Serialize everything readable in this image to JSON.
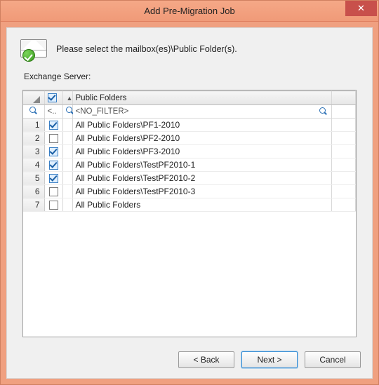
{
  "window": {
    "title": "Add Pre-Migration Job",
    "close_glyph": "✕"
  },
  "instruction": "Please select the mailbox(es)\\Public Folder(s).",
  "section_label": "Exchange Server:",
  "grid": {
    "header": {
      "col_path": "Public Folders"
    },
    "header_checkbox_checked": true,
    "filter": {
      "prefix": "<..",
      "placeholder": "<NO_FILTER>"
    },
    "rows": [
      {
        "n": "1",
        "checked": true,
        "path": "All Public Folders\\PF1-2010"
      },
      {
        "n": "2",
        "checked": false,
        "path": "All Public Folders\\PF2-2010"
      },
      {
        "n": "3",
        "checked": true,
        "path": "All Public Folders\\PF3-2010"
      },
      {
        "n": "4",
        "checked": true,
        "path": "All Public Folders\\TestPF2010-1"
      },
      {
        "n": "5",
        "checked": true,
        "path": "All Public Folders\\TestPF2010-2"
      },
      {
        "n": "6",
        "checked": false,
        "path": "All Public Folders\\TestPF2010-3"
      },
      {
        "n": "7",
        "checked": false,
        "path": "All Public Folders"
      }
    ]
  },
  "footer": {
    "back": "< Back",
    "next": "Next >",
    "cancel": "Cancel"
  }
}
